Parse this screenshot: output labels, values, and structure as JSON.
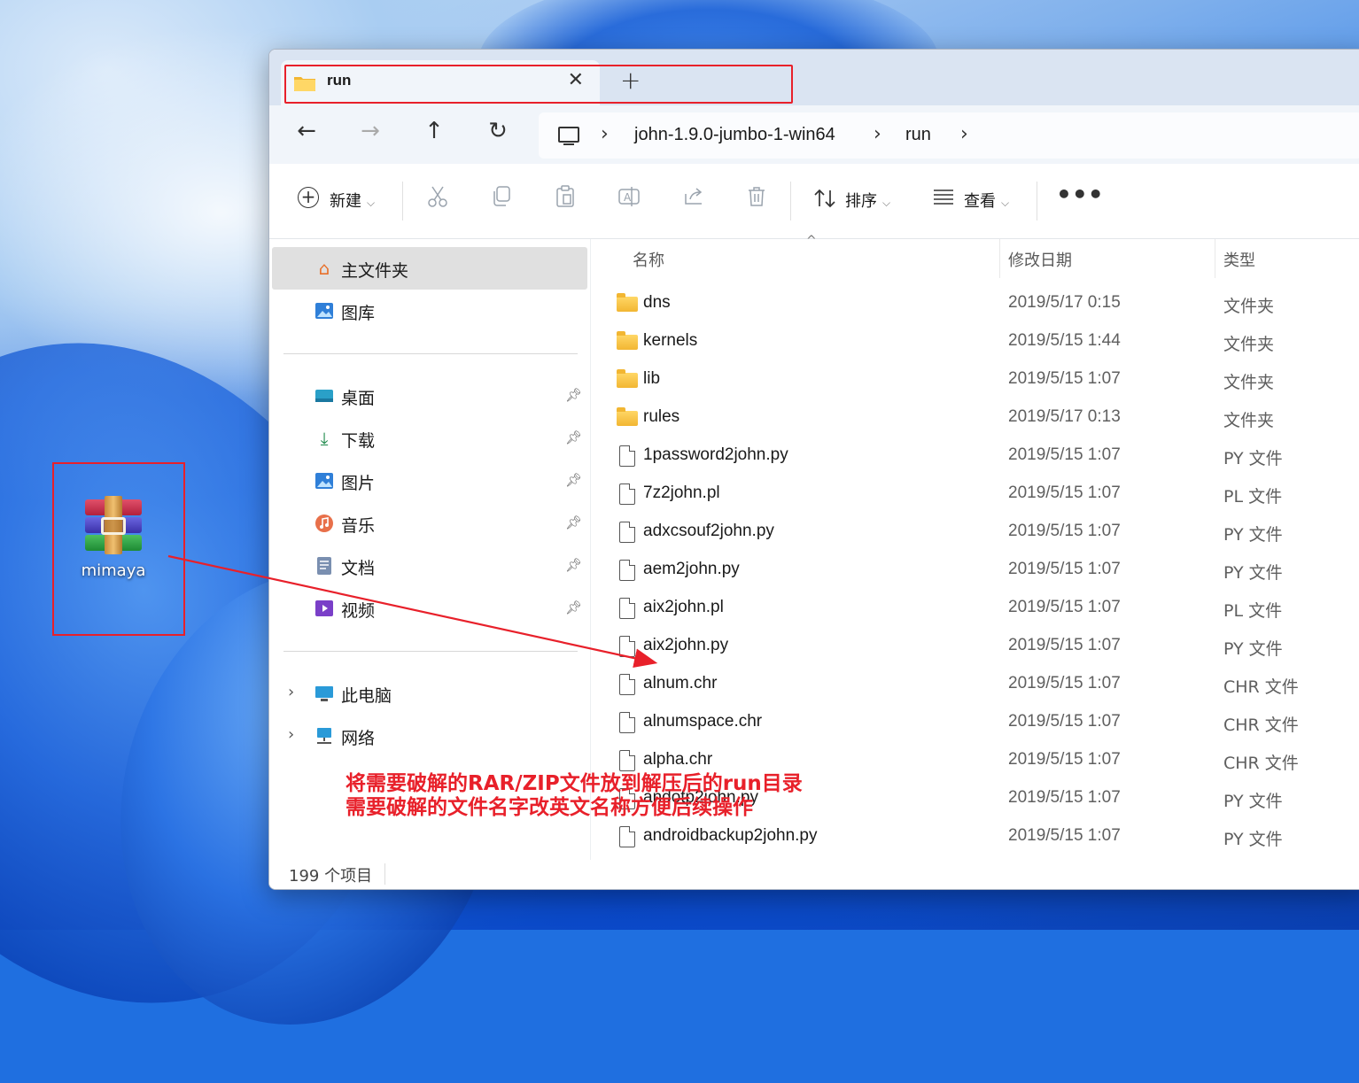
{
  "desktop": {
    "icon_label": "mimaya"
  },
  "window": {
    "tab_title": "run",
    "tab_close": "✕",
    "new_tab": "+",
    "nav": {
      "back": "←",
      "forward": "→",
      "up": "↑",
      "refresh": "↻"
    },
    "breadcrumb": [
      "john-1.9.0-jumbo-1-win64",
      "run"
    ],
    "chevron": "›",
    "toolbar": {
      "new_label": "新建",
      "sort_label": "排序",
      "view_label": "查看",
      "more": "•••",
      "dropdown": "⌵"
    },
    "sidebar": {
      "top": [
        {
          "label": "主文件夹",
          "icon": "home-icon"
        },
        {
          "label": "图库",
          "icon": "gallery-icon"
        }
      ],
      "pinned": [
        {
          "label": "桌面",
          "icon": "desktop-icon"
        },
        {
          "label": "下载",
          "icon": "download-icon"
        },
        {
          "label": "图片",
          "icon": "pictures-icon"
        },
        {
          "label": "音乐",
          "icon": "music-icon"
        },
        {
          "label": "文档",
          "icon": "documents-icon"
        },
        {
          "label": "视频",
          "icon": "videos-icon"
        }
      ],
      "bottom": [
        {
          "label": "此电脑",
          "icon": "this-pc-icon"
        },
        {
          "label": "网络",
          "icon": "network-icon"
        }
      ]
    },
    "columns": {
      "name": "名称",
      "date": "修改日期",
      "type": "类型"
    },
    "files": [
      {
        "name": "dns",
        "date": "2019/5/17 0:15",
        "type": "文件夹",
        "kind": "folder"
      },
      {
        "name": "kernels",
        "date": "2019/5/15 1:44",
        "type": "文件夹",
        "kind": "folder"
      },
      {
        "name": "lib",
        "date": "2019/5/15 1:07",
        "type": "文件夹",
        "kind": "folder"
      },
      {
        "name": "rules",
        "date": "2019/5/17 0:13",
        "type": "文件夹",
        "kind": "folder"
      },
      {
        "name": "1password2john.py",
        "date": "2019/5/15 1:07",
        "type": "PY 文件",
        "kind": "file"
      },
      {
        "name": "7z2john.pl",
        "date": "2019/5/15 1:07",
        "type": "PL 文件",
        "kind": "file"
      },
      {
        "name": "adxcsouf2john.py",
        "date": "2019/5/15 1:07",
        "type": "PY 文件",
        "kind": "file"
      },
      {
        "name": "aem2john.py",
        "date": "2019/5/15 1:07",
        "type": "PY 文件",
        "kind": "file"
      },
      {
        "name": "aix2john.pl",
        "date": "2019/5/15 1:07",
        "type": "PL 文件",
        "kind": "file"
      },
      {
        "name": "aix2john.py",
        "date": "2019/5/15 1:07",
        "type": "PY 文件",
        "kind": "file"
      },
      {
        "name": "alnum.chr",
        "date": "2019/5/15 1:07",
        "type": "CHR 文件",
        "kind": "file"
      },
      {
        "name": "alnumspace.chr",
        "date": "2019/5/15 1:07",
        "type": "CHR 文件",
        "kind": "file"
      },
      {
        "name": "alpha.chr",
        "date": "2019/5/15 1:07",
        "type": "CHR 文件",
        "kind": "file"
      },
      {
        "name": "andotp2john.py",
        "date": "2019/5/15 1:07",
        "type": "PY 文件",
        "kind": "file"
      },
      {
        "name": "androidbackup2john.py",
        "date": "2019/5/15 1:07",
        "type": "PY 文件",
        "kind": "file"
      }
    ],
    "status": "199 个项目"
  },
  "annotation": {
    "line1": "将需要破解的RAR/ZIP文件放到解压后的run目录",
    "line2": "需要破解的文件名字改英文名称方便后续操作",
    "color": "#e8202a"
  }
}
